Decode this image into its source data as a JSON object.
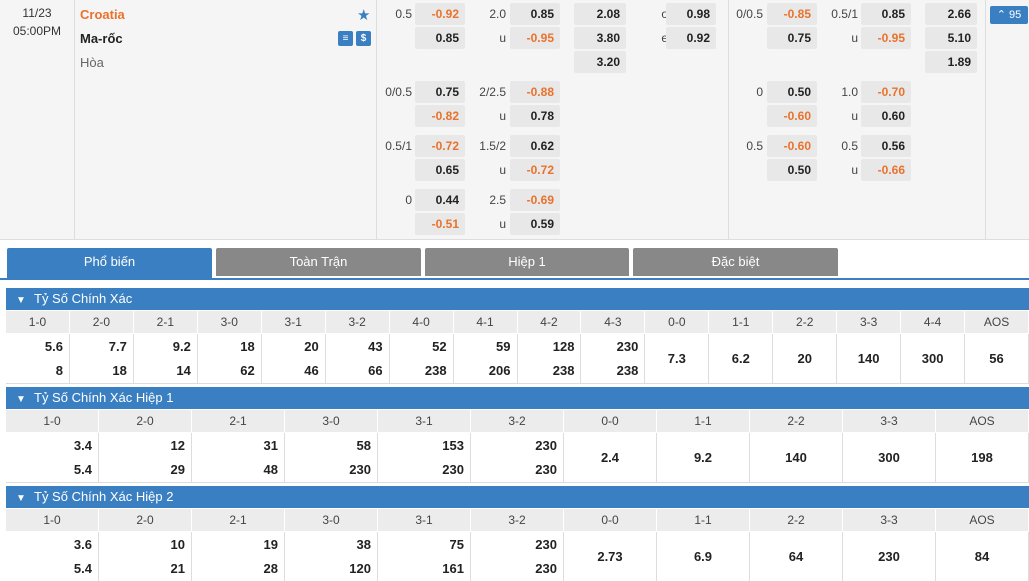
{
  "match": {
    "date": "11/23",
    "time": "05:00PM",
    "home": "Croatia",
    "away": "Ma-rốc",
    "draw": "Hòa",
    "more_count": "95"
  },
  "odds_rows": [
    {
      "hdp": "0.5",
      "h1": "-0.92",
      "h2": "0.85",
      "ou": "2.0",
      "o1": "0.85",
      "o2": "-0.95",
      "x1": "2.08",
      "x2": "3.80",
      "x3": "3.20",
      "oe_o": "0.98",
      "oe_e": "0.92",
      "fh_hdp": "0/0.5",
      "fh1": "-0.85",
      "fh2": "0.75",
      "fh_ou": "0.5/1",
      "fo1": "0.85",
      "fo2": "-0.95",
      "fx1": "2.66",
      "fx2": "5.10",
      "fx3": "1.89"
    },
    {
      "hdp": "0/0.5",
      "h1": "0.75",
      "h2": "-0.82",
      "ou": "2/2.5",
      "o1": "-0.88",
      "o2": "0.78",
      "fh_hdp": "0",
      "fh1": "0.50",
      "fh2": "-0.60",
      "fh_ou": "1.0",
      "fo1": "-0.70",
      "fo2": "0.60"
    },
    {
      "hdp": "0.5/1",
      "h1": "-0.72",
      "h2": "0.65",
      "ou": "1.5/2",
      "o1": "0.62",
      "o2": "-0.72",
      "fh_hdp": "0.5",
      "fh1": "-0.60",
      "fh2": "0.50",
      "fh_ou": "0.5",
      "fo1": "0.56",
      "fo2": "-0.66"
    },
    {
      "hdp": "0",
      "h1": "0.44",
      "h2": "-0.51",
      "ou": "2.5",
      "o1": "-0.69",
      "o2": "0.59"
    }
  ],
  "labels": {
    "o": "o",
    "u": "u",
    "e": "e"
  },
  "tabs": [
    "Phổ biến",
    "Toàn Trận",
    "Hiệp 1",
    "Đặc biệt"
  ],
  "sections": [
    {
      "title": "Tỷ Số Chính Xác",
      "headers": [
        "1-0",
        "2-0",
        "2-1",
        "3-0",
        "3-1",
        "3-2",
        "4-0",
        "4-1",
        "4-2",
        "4-3",
        "0-0",
        "1-1",
        "2-2",
        "3-3",
        "4-4",
        "AOS"
      ],
      "top": [
        "5.6",
        "7.7",
        "9.2",
        "18",
        "20",
        "43",
        "52",
        "59",
        "128",
        "230",
        "",
        "",
        "",
        "",
        "",
        ""
      ],
      "bottom": [
        "8",
        "18",
        "14",
        "62",
        "46",
        "66",
        "238",
        "206",
        "238",
        "238",
        "",
        "",
        "",
        "",
        "",
        ""
      ],
      "center": [
        "",
        "",
        "",
        "",
        "",
        "",
        "",
        "",
        "",
        "",
        "7.3",
        "6.2",
        "20",
        "140",
        "300",
        "56"
      ]
    },
    {
      "title": "Tỷ Số Chính Xác Hiệp 1",
      "headers": [
        "1-0",
        "2-0",
        "2-1",
        "3-0",
        "3-1",
        "3-2",
        "0-0",
        "1-1",
        "2-2",
        "3-3",
        "AOS"
      ],
      "top": [
        "3.4",
        "12",
        "31",
        "58",
        "153",
        "230",
        "",
        "",
        "",
        "",
        ""
      ],
      "bottom": [
        "5.4",
        "29",
        "48",
        "230",
        "230",
        "230",
        "",
        "",
        "",
        "",
        ""
      ],
      "center": [
        "",
        "",
        "",
        "",
        "",
        "",
        "2.4",
        "9.2",
        "140",
        "300",
        "198"
      ]
    },
    {
      "title": "Tỷ Số Chính Xác Hiệp 2",
      "headers": [
        "1-0",
        "2-0",
        "2-1",
        "3-0",
        "3-1",
        "3-2",
        "0-0",
        "1-1",
        "2-2",
        "3-3",
        "AOS"
      ],
      "top": [
        "3.6",
        "10",
        "19",
        "38",
        "75",
        "230",
        "",
        "",
        "",
        "",
        ""
      ],
      "bottom": [
        "5.4",
        "21",
        "28",
        "120",
        "161",
        "230",
        "",
        "",
        "",
        "",
        ""
      ],
      "center": [
        "",
        "",
        "",
        "",
        "",
        "",
        "2.73",
        "6.9",
        "64",
        "230",
        "84"
      ]
    }
  ],
  "colors": {
    "accent": "#3a7fc2",
    "negative": "#e9722c",
    "tab_inactive": "#888888"
  },
  "icons": {
    "favorite": "star-icon",
    "stats": "stats-icon",
    "money": "dollar-icon"
  }
}
